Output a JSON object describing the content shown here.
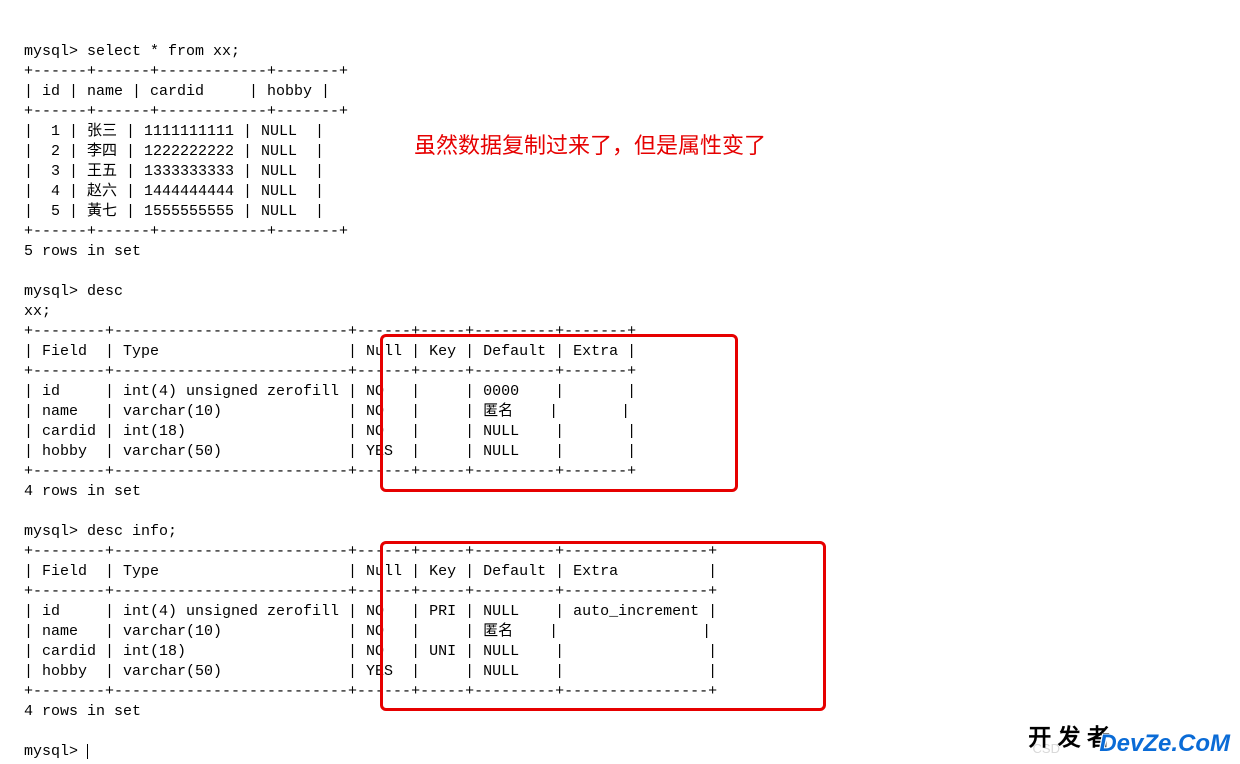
{
  "terminal": {
    "line1": "mysql> select * from xx;",
    "sep1": "+------+------+------------+-------+",
    "hdr1": "| id | name | cardid     | hobby |",
    "row1": "|  1 | 张三 | 1111111111 | NULL  |",
    "row2": "|  2 | 李四 | 1222222222 | NULL  |",
    "row3": "|  3 | 王五 | 1333333333 | NULL  |",
    "row4": "|  4 | 赵六 | 1444444444 | NULL  |",
    "row5": "|  5 | 黃七 | 1555555555 | NULL  |",
    "rows_result": "5 rows in set",
    "desc_cmd": "mysql> desc",
    "desc_target": "xx;",
    "sep2a": "+--------+--------------------------+------+-----+---------+-------+",
    "hdr2": "| Field  | Type                     | Null | Key | Default | Extra |",
    "d1": "| id     | int(4) unsigned zerofill | NO   |     | 0000    |       |",
    "d2": "| name   | varchar(10)              | NO   |     | 匿名    |       |",
    "d3": "| cardid | int(18)                  | NO   |     | NULL    |       |",
    "d4": "| hobby  | varchar(50)              | YES  |     | NULL    |       |",
    "rows_result2": "4 rows in set",
    "desc_info": "mysql> desc info;",
    "sep3a": "+--------+--------------------------+------+-----+---------+----------------+",
    "hdr3": "| Field  | Type                     | Null | Key | Default | Extra          |",
    "e1": "| id     | int(4) unsigned zerofill | NO   | PRI | NULL    | auto_increment |",
    "e2": "| name   | varchar(10)              | NO   |     | 匿名    |                |",
    "e3": "| cardid | int(18)                  | NO   | UNI | NULL    |                |",
    "e4": "| hobby  | varchar(50)              | YES  |     | NULL    |                |",
    "rows_result3": "4 rows in set",
    "prompt": "mysql> "
  },
  "annotation": "虽然数据复制过来了，但是属性变了",
  "watermark_main1": "开 发 者",
  "watermark_main2": "DevZe.CoM",
  "watermark_small": "CSD"
}
